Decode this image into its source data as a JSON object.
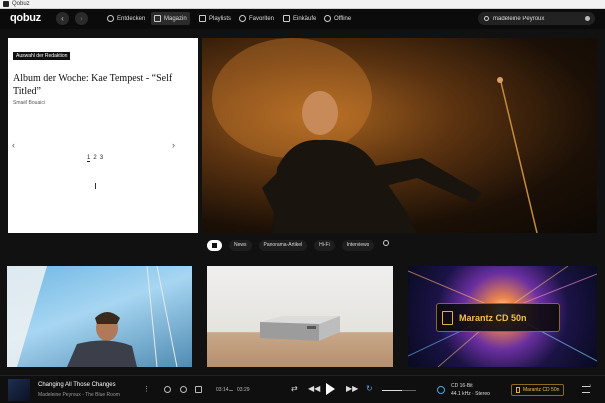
{
  "window": {
    "title": "Qobuz"
  },
  "header": {
    "logo": "qobuz",
    "nav": [
      {
        "label": "Entdecken"
      },
      {
        "label": "Magazin"
      },
      {
        "label": "Playlists"
      },
      {
        "label": "Favoriten"
      },
      {
        "label": "Einkäufe"
      },
      {
        "label": "Offline"
      }
    ],
    "active_nav": "Magazin",
    "search": {
      "value": "madeleine Peyroux"
    }
  },
  "hero": {
    "badge": "Auswahl der Redaktion",
    "title": "Album der Woche: Kae Tempest - “Self Titled”",
    "author": "Smaël Bouaici",
    "pages": [
      "1",
      "2",
      "3"
    ],
    "current_page": "1"
  },
  "tabs": [
    "News",
    "Panorama-Artikel",
    "Hi-Fi",
    "Interviews"
  ],
  "articles": {
    "promo_text": "Marantz CD 50n"
  },
  "player": {
    "track": "Changing All Those Changes",
    "artist_album": "Madeleine Peyroux - The Blue Room",
    "elapsed": "03:14",
    "total": "03:29",
    "format_line1": "CD 16-Bit",
    "format_line2": "44.1 kHz · Stereo",
    "device": "Marantz CD 50n",
    "queue_count": "1"
  },
  "colors": {
    "accent": "#f0c04a",
    "quality": "#4aa3e6"
  }
}
